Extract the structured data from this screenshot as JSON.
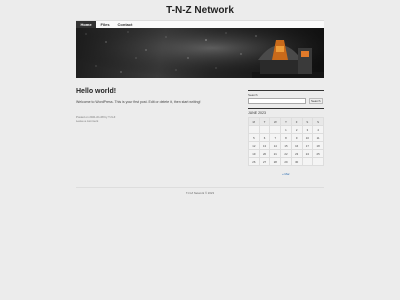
{
  "site": {
    "title": "T-N-Z Network"
  },
  "nav": {
    "items": [
      "Home",
      "Files",
      "Contact"
    ]
  },
  "post": {
    "title": "Hello world!",
    "text": "Welcome to WordPress. This is your first post. Edit or delete it, then start writing!",
    "meta_line1": "Posted on 2021-01-08 by T-N-Z",
    "meta_line2": "Leave a comment"
  },
  "search": {
    "label": "Search",
    "button": "Search",
    "value": ""
  },
  "calendar": {
    "title": "JUNE 2023",
    "headers": [
      "M",
      "T",
      "W",
      "T",
      "F",
      "S",
      "S"
    ],
    "rows": [
      [
        "",
        "",
        "",
        "1",
        "2",
        "3",
        "4"
      ],
      [
        "5",
        "6",
        "7",
        "8",
        "9",
        "10",
        "11"
      ],
      [
        "12",
        "13",
        "14",
        "15",
        "16",
        "17",
        "18"
      ],
      [
        "19",
        "20",
        "21",
        "22",
        "23",
        "24",
        "25"
      ],
      [
        "26",
        "27",
        "28",
        "29",
        "30",
        "",
        ""
      ]
    ],
    "prev": "« Mar"
  },
  "footer": {
    "text": "T-N-Z Network © 2023"
  },
  "colors": {
    "nav_active": "#333333",
    "link": "#2b6cb0",
    "background": "#ececec"
  },
  "header_image": {
    "icon": "observatory-dome-at-night"
  }
}
